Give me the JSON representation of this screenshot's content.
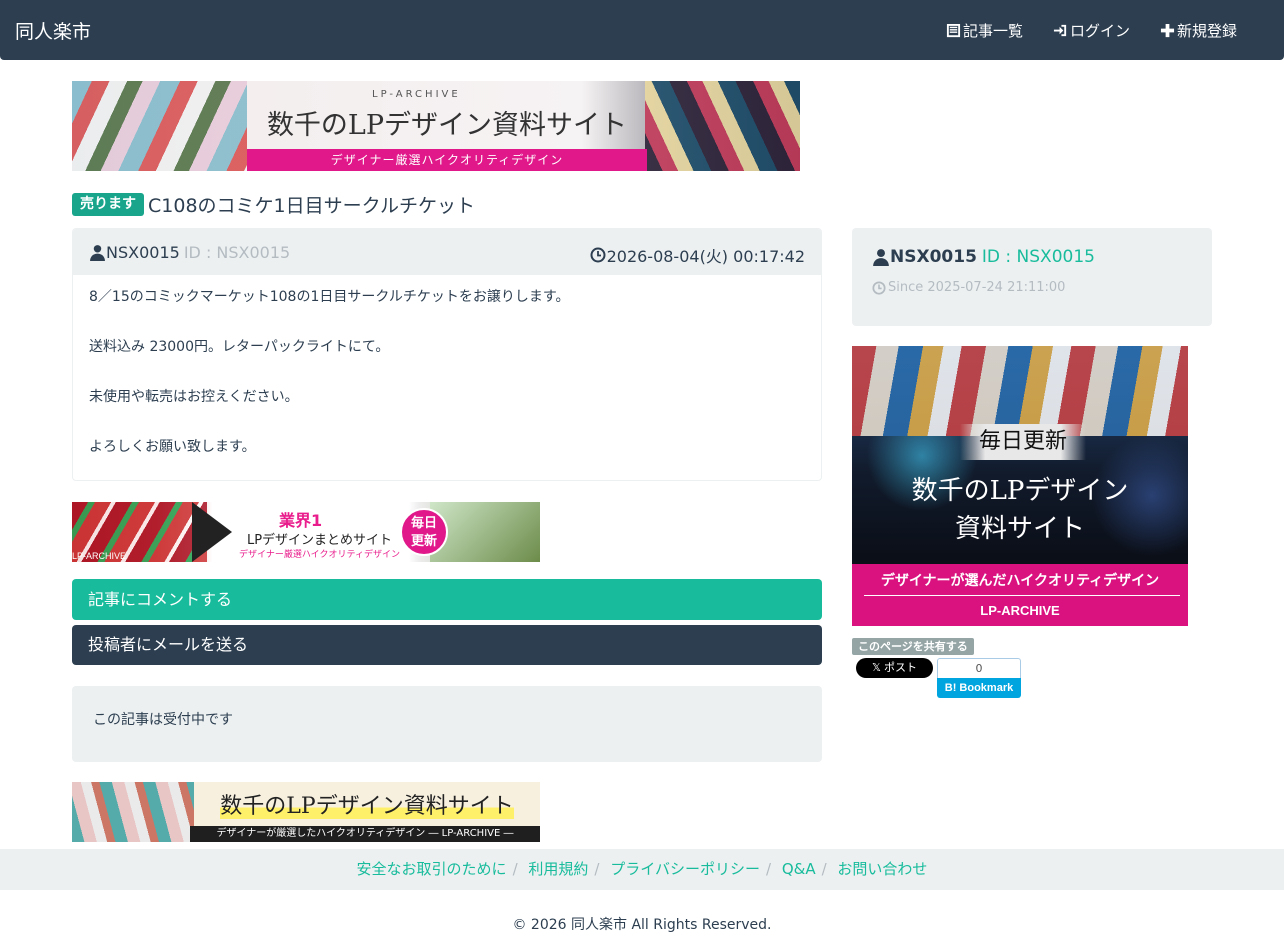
{
  "navbar": {
    "brand": "同人楽市",
    "items": [
      {
        "label": "記事一覧",
        "icon": "list-icon"
      },
      {
        "label": "ログイン",
        "icon": "login-icon"
      },
      {
        "label": "新規登録",
        "icon": "plus-icon"
      }
    ]
  },
  "ads": {
    "top": {
      "tag": "LP-ARCHIVE",
      "headline": "数千のLPデザイン資料サイト",
      "strip": "デザイナー厳選ハイクオリティデザイン"
    },
    "small": {
      "label": "LP-ARCHIVE",
      "rank": "業界1",
      "title": "LPデザインまとめサイト",
      "sub": "デザイナー厳選ハイクオリティデザイン",
      "badge_line1": "毎日",
      "badge_line2": "更新"
    },
    "bottom": {
      "title": "数千のLPデザイン資料サイト",
      "strip": "デザイナーが厳選したハイクオリティデザイン ― LP-ARCHIVE ―"
    },
    "side": {
      "daily": "毎日更新",
      "head1": "数千のLPデザイン",
      "head2": "資料サイト",
      "sub": "デザイナーが選んだハイクオリティデザイン",
      "brand": "LP-ARCHIVE"
    }
  },
  "post": {
    "badge": "売ります",
    "title": "C108のコミケ1日目サークルチケット",
    "author": "NSX0015",
    "author_id": "ID : NSX0015",
    "date": "2026-08-04(火) 00:17:42",
    "body": [
      "8／15のコミックマーケット108の1日目サークルチケットをお譲りします。",
      "送料込み 23000円。レターパックライトにて。",
      "未使用や転売はお控えください。",
      "よろしくお願い致します。"
    ]
  },
  "actions": {
    "comment": "記事にコメントする",
    "mail": "投稿者にメールを送る"
  },
  "status": "この記事は受付中です",
  "sidebar": {
    "author": "NSX0015",
    "author_id": "ID : NSX0015",
    "since": "Since 2025-07-24 21:11:00",
    "share_label": "このページを共有する",
    "x_post": "𝕏 ポスト",
    "hatena_count": "0",
    "hatena_label": "B! Bookmark"
  },
  "footer": {
    "links": [
      "安全なお取引のために",
      "利用規約",
      "プライバシーポリシー",
      "Q&A",
      "お問い合わせ"
    ],
    "copyright": "© 2026 同人楽市 All Rights Reserved."
  },
  "colors": {
    "navbar": "#2c3e50",
    "accent": "#18bc9c",
    "badge": "#18a58c",
    "panel": "#ecf0f1",
    "muted": "#b4bcc2"
  }
}
